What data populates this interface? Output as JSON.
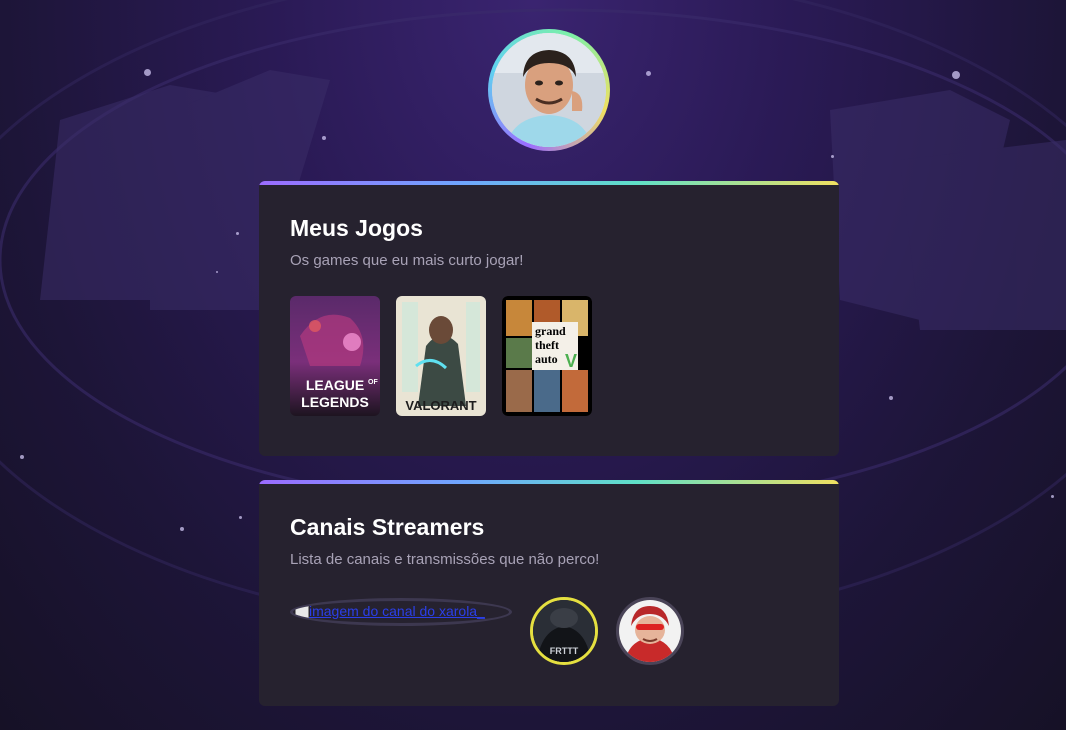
{
  "games_section": {
    "title": "Meus Jogos",
    "subtitle": "Os games que eu mais curto jogar!",
    "items": [
      {
        "name": "League of Legends",
        "line1": "LEAGUE",
        "line1b": "OF",
        "line2": "LEGENDS"
      },
      {
        "name": "Valorant",
        "logo": "VALORANT"
      },
      {
        "name": "Grand Theft Auto V",
        "line1": "grand",
        "line2": "theft",
        "line3": "auto",
        "numeral": "V"
      }
    ]
  },
  "streamers_section": {
    "title": "Canais Streamers",
    "subtitle": "Lista de canais e transmissões que não perco!",
    "broken_image_alt": "imagem do canal do xarola_",
    "items": [
      {
        "name": "channel-2",
        "shirt_text": "FRTTT"
      },
      {
        "name": "channel-3"
      }
    ]
  },
  "colors": {
    "card_bg": "#26222f",
    "accent_gradient": [
      "#9b6cff",
      "#5fe0c8",
      "#f0e060"
    ],
    "title": "#ffffff",
    "subtitle": "#a8a2b6"
  }
}
